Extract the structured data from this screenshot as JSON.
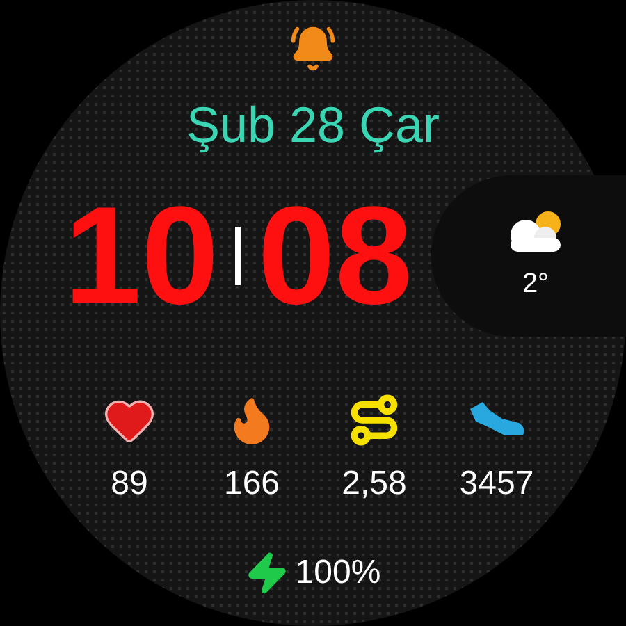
{
  "date": "Şub 28 Çar",
  "time": {
    "hours": "10",
    "minutes": "08"
  },
  "weather": {
    "temperature": "2°"
  },
  "stats": [
    {
      "kind": "heart",
      "value": "89"
    },
    {
      "kind": "calories",
      "value": "166"
    },
    {
      "kind": "distance",
      "value": "2,58"
    },
    {
      "kind": "steps",
      "value": "3457"
    }
  ],
  "battery": {
    "reading": "100%"
  }
}
